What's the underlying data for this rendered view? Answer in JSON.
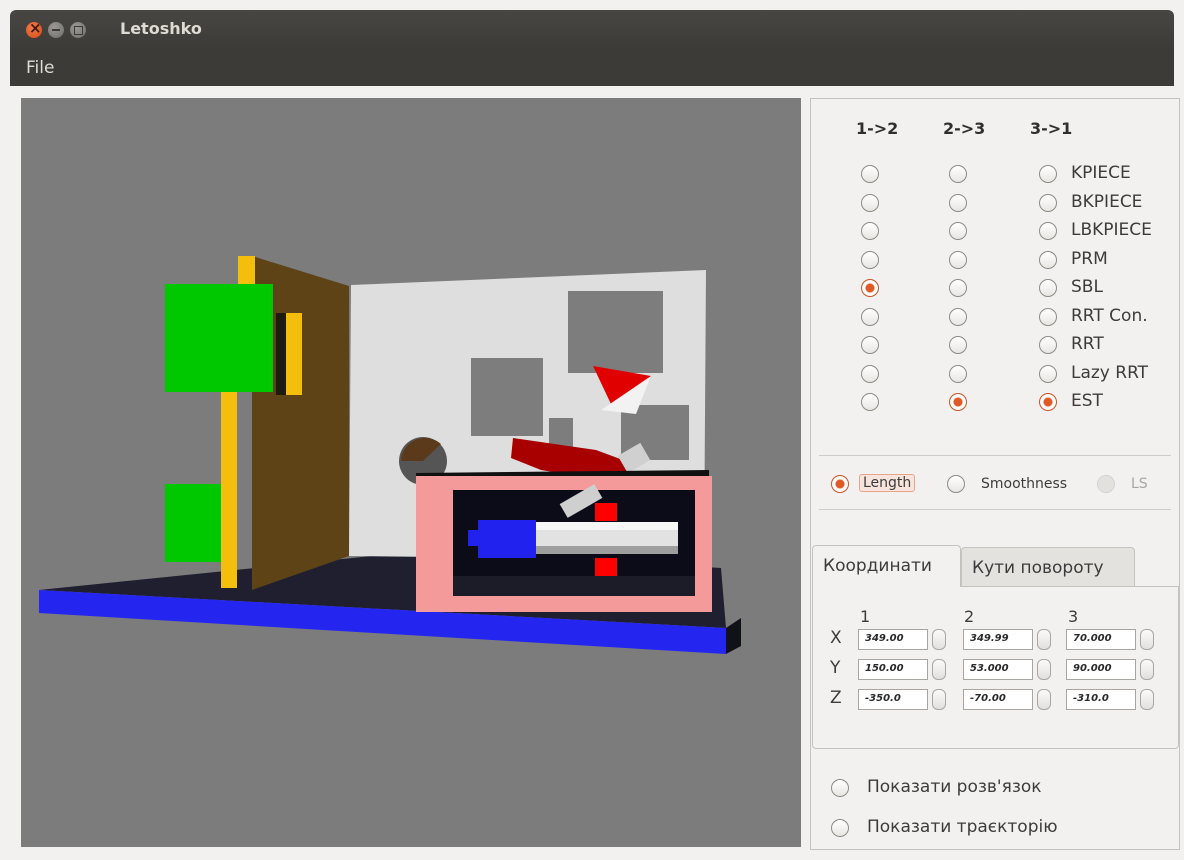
{
  "window": {
    "title": "Letoshko"
  },
  "menu": {
    "file": "File"
  },
  "planner": {
    "columns": [
      "1->2",
      "2->3",
      "3->1"
    ],
    "algorithms": [
      "KPIECE",
      "BKPIECE",
      "LBKPIECE",
      "PRM",
      "SBL",
      "RRT Con.",
      "RRT",
      "Lazy RRT",
      "EST"
    ],
    "selected": {
      "1->2": "SBL",
      "2->3": "EST",
      "3->1": "EST"
    }
  },
  "metric": {
    "options": [
      "Length",
      "Smoothness",
      "LS"
    ],
    "selected": "Length",
    "disabled": [
      "LS"
    ]
  },
  "tabs": {
    "active": "Координати",
    "inactive": "Кути повороту"
  },
  "coordinates": {
    "headers": [
      "1",
      "2",
      "3"
    ],
    "rows": [
      {
        "axis": "X",
        "values": [
          "349.00",
          "349.99",
          "70.000"
        ]
      },
      {
        "axis": "Y",
        "values": [
          "150.00",
          "53.000",
          "90.000"
        ]
      },
      {
        "axis": "Z",
        "values": [
          "-350.0",
          "-70.00",
          "-310.0"
        ]
      }
    ]
  },
  "options": {
    "show_solution": "Показати розв'язок",
    "show_trajectory": "Показати траєкторію"
  },
  "scene_colors": {
    "background": "#7c7c7c",
    "base": "#1f1f2f",
    "base_edge": "#1a1aff",
    "wall": "#dcdcdc",
    "door": "#5a4113",
    "frame": "#f2bd0e",
    "green_block": "#00c800",
    "pink_box": "#f59a9a",
    "red_parts": "#d40000",
    "blue_tool": "#2222ee"
  }
}
